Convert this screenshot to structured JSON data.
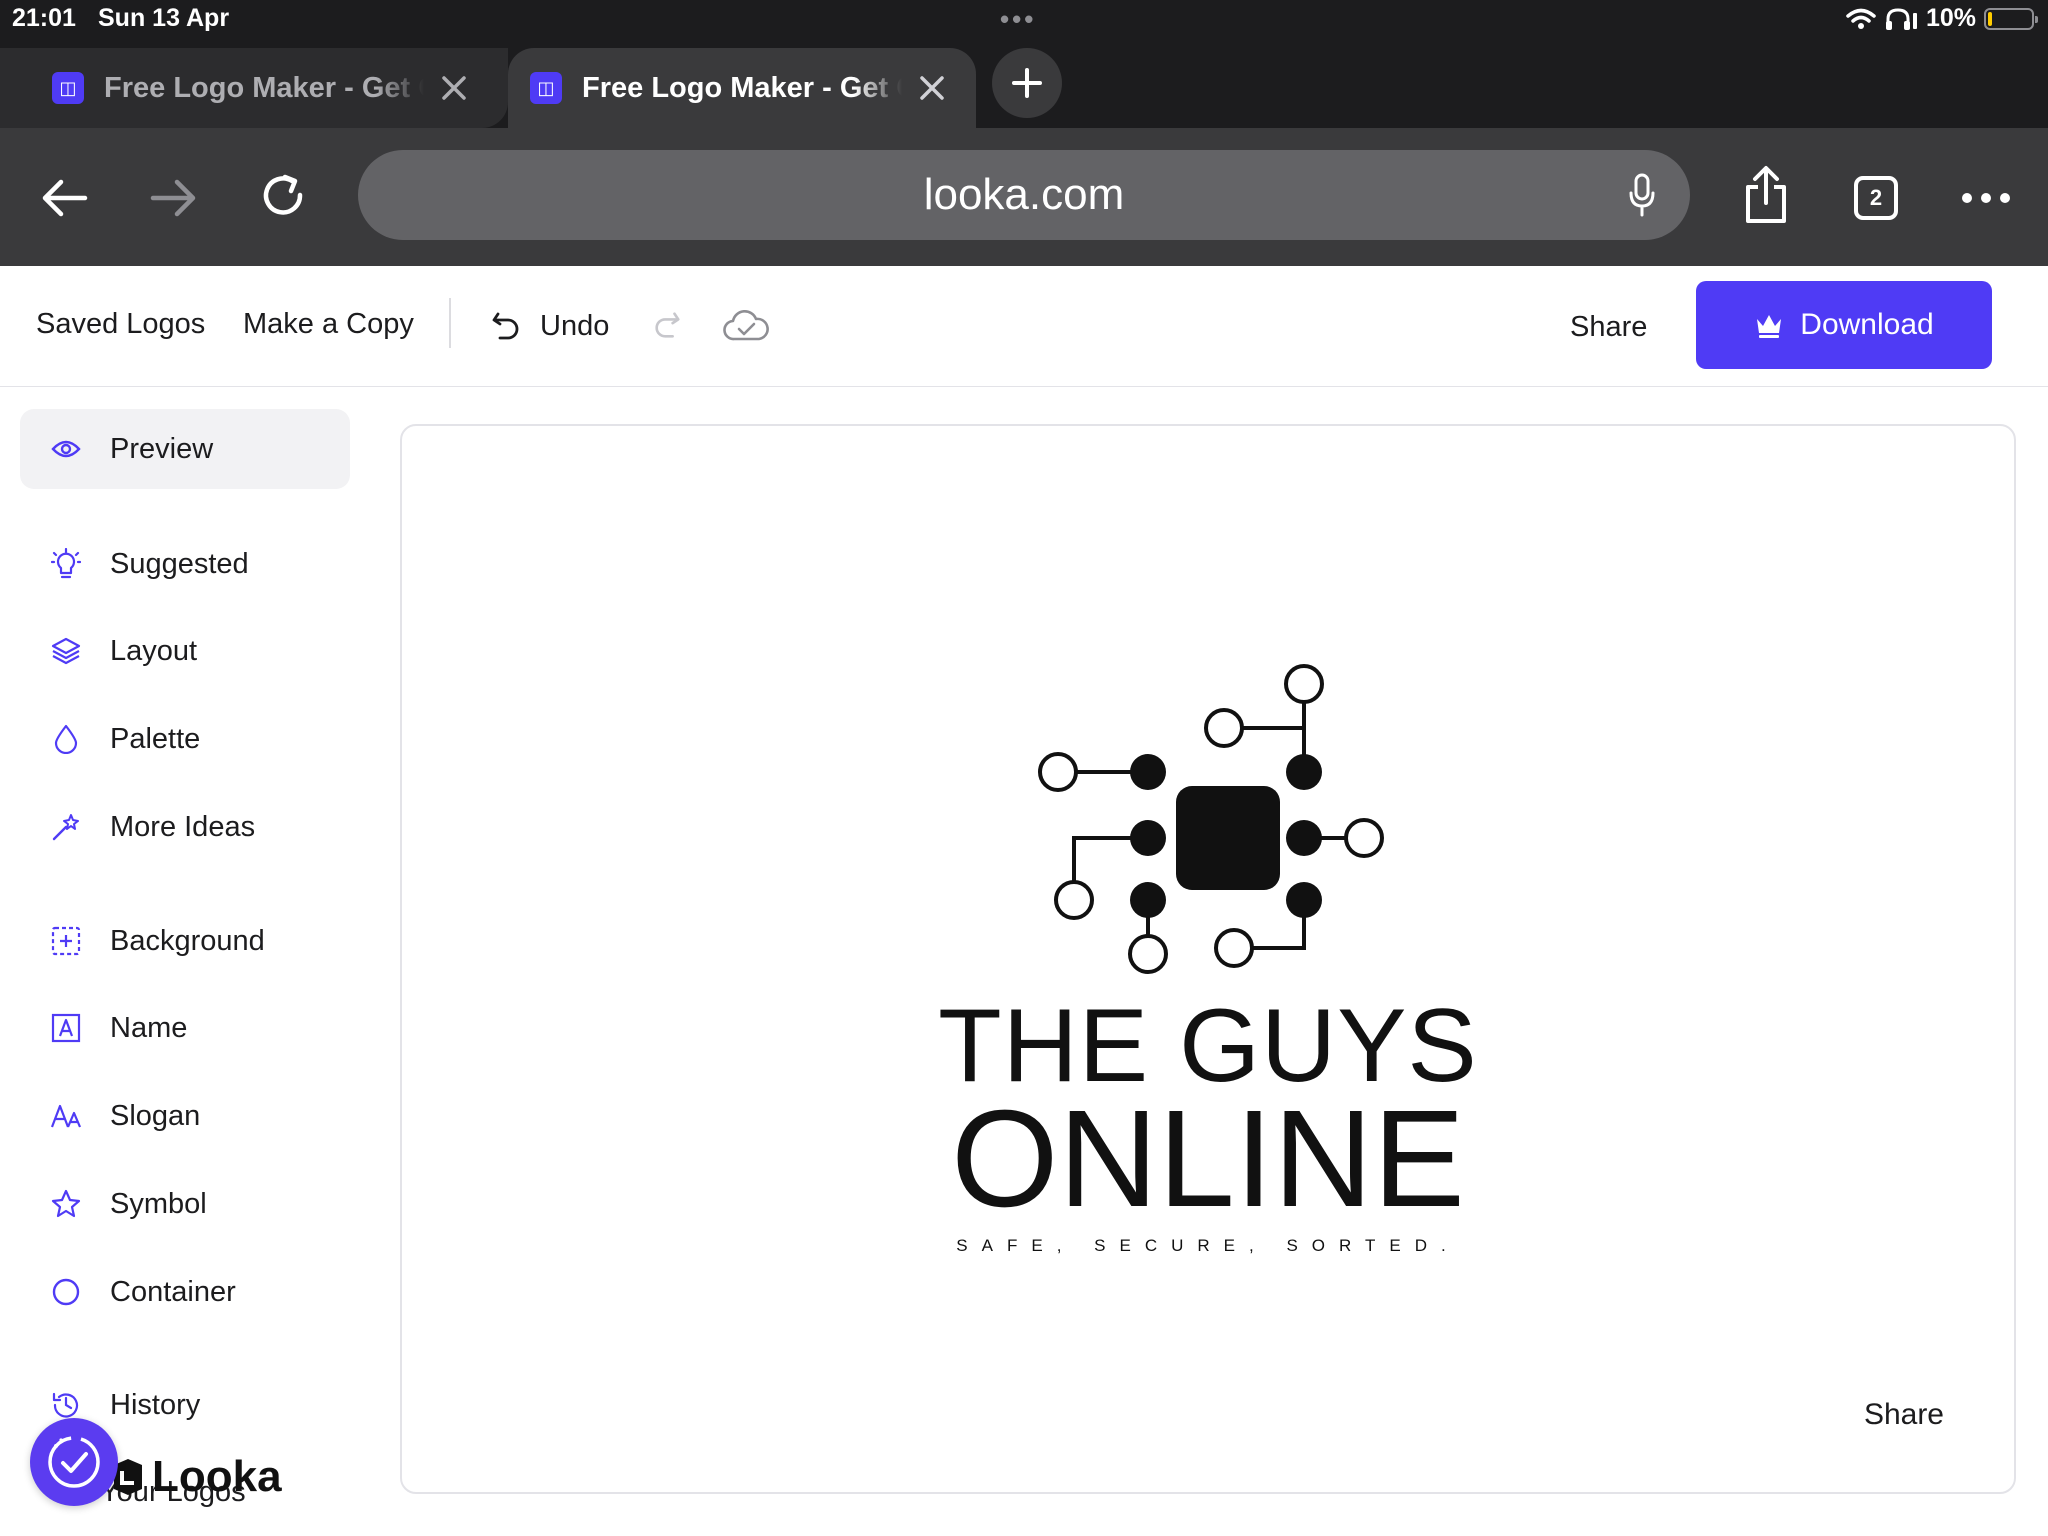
{
  "status_bar": {
    "time": "21:01",
    "date": "Sun 13 Apr",
    "battery": "10%",
    "battery_level": 0.1
  },
  "browser": {
    "tabs": [
      {
        "title": "Free Logo Maker - Get Custom Logos",
        "favicon": "looka-icon",
        "active": false
      },
      {
        "title": "Free Logo Maker - Get Custom Logos",
        "favicon": "looka-icon",
        "active": true
      }
    ],
    "url": "looka.com",
    "tab_count": "2"
  },
  "header": {
    "saved_logos": "Saved Logos",
    "make_copy": "Make a Copy",
    "undo": "Undo",
    "share": "Share",
    "download": "Download"
  },
  "sidebar": {
    "items": [
      {
        "label": "Preview",
        "icon": "eye-icon",
        "active": true
      },
      {
        "label": "Suggested",
        "icon": "lightbulb-icon"
      },
      {
        "label": "Layout",
        "icon": "layers-icon"
      },
      {
        "label": "Palette",
        "icon": "droplet-icon"
      },
      {
        "label": "More Ideas",
        "icon": "magic-wand-icon"
      },
      {
        "label": "Background",
        "icon": "background-icon"
      },
      {
        "label": "Name",
        "icon": "name-icon"
      },
      {
        "label": "Slogan",
        "icon": "slogan-icon"
      },
      {
        "label": "Symbol",
        "icon": "star-icon"
      },
      {
        "label": "Container",
        "icon": "circle-icon"
      },
      {
        "label": "History",
        "icon": "history-icon"
      }
    ],
    "partial_item": "Your Logos",
    "brand": "Looka"
  },
  "logo": {
    "name_line_1": "THE GUYS",
    "name_line_2": "ONLINE",
    "slogan": "SAFE, SECURE, SORTED."
  },
  "canvas": {
    "share": "Share"
  },
  "colors": {
    "accent": "#4f3bf5",
    "chrome_dark": "#1c1c1e",
    "toolbar": "#3a3a3c"
  }
}
